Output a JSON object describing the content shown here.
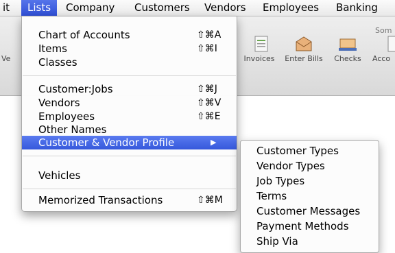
{
  "menubar": {
    "items": [
      {
        "label": "it"
      },
      {
        "label": "Lists"
      },
      {
        "label": "Company"
      },
      {
        "label": "Customers"
      },
      {
        "label": "Vendors"
      },
      {
        "label": "Employees"
      },
      {
        "label": "Banking"
      }
    ]
  },
  "toolbar": {
    "partial_label": "Som",
    "left_partial": "Ve",
    "buttons": [
      {
        "label": "Invoices"
      },
      {
        "label": "Enter Bills"
      },
      {
        "label": "Checks"
      },
      {
        "label": "Acco"
      }
    ]
  },
  "lists_menu": {
    "items": [
      {
        "label": "Chart of Accounts",
        "shortcut": "⇧⌘A"
      },
      {
        "label": "Items",
        "shortcut": "⇧⌘I"
      },
      {
        "label": "Classes",
        "shortcut": ""
      },
      {
        "label": "Customer:Jobs",
        "shortcut": "⇧⌘J"
      },
      {
        "label": "Vendors",
        "shortcut": "⇧⌘V"
      },
      {
        "label": "Employees",
        "shortcut": "⇧⌘E"
      },
      {
        "label": "Other Names",
        "shortcut": ""
      },
      {
        "label": "Customer & Vendor Profile",
        "submenu_arrow": "▶"
      },
      {
        "label": "Vehicles",
        "shortcut": ""
      },
      {
        "label": "Memorized Transactions",
        "shortcut": "⇧⌘M"
      }
    ]
  },
  "profile_submenu": {
    "items": [
      {
        "label": "Customer Types"
      },
      {
        "label": "Vendor Types"
      },
      {
        "label": "Job Types"
      },
      {
        "label": "Terms"
      },
      {
        "label": "Customer Messages"
      },
      {
        "label": "Payment Methods"
      },
      {
        "label": "Ship Via"
      }
    ]
  },
  "colors": {
    "highlight": "#3a5de0",
    "menu_background": "#fcfcfc"
  }
}
